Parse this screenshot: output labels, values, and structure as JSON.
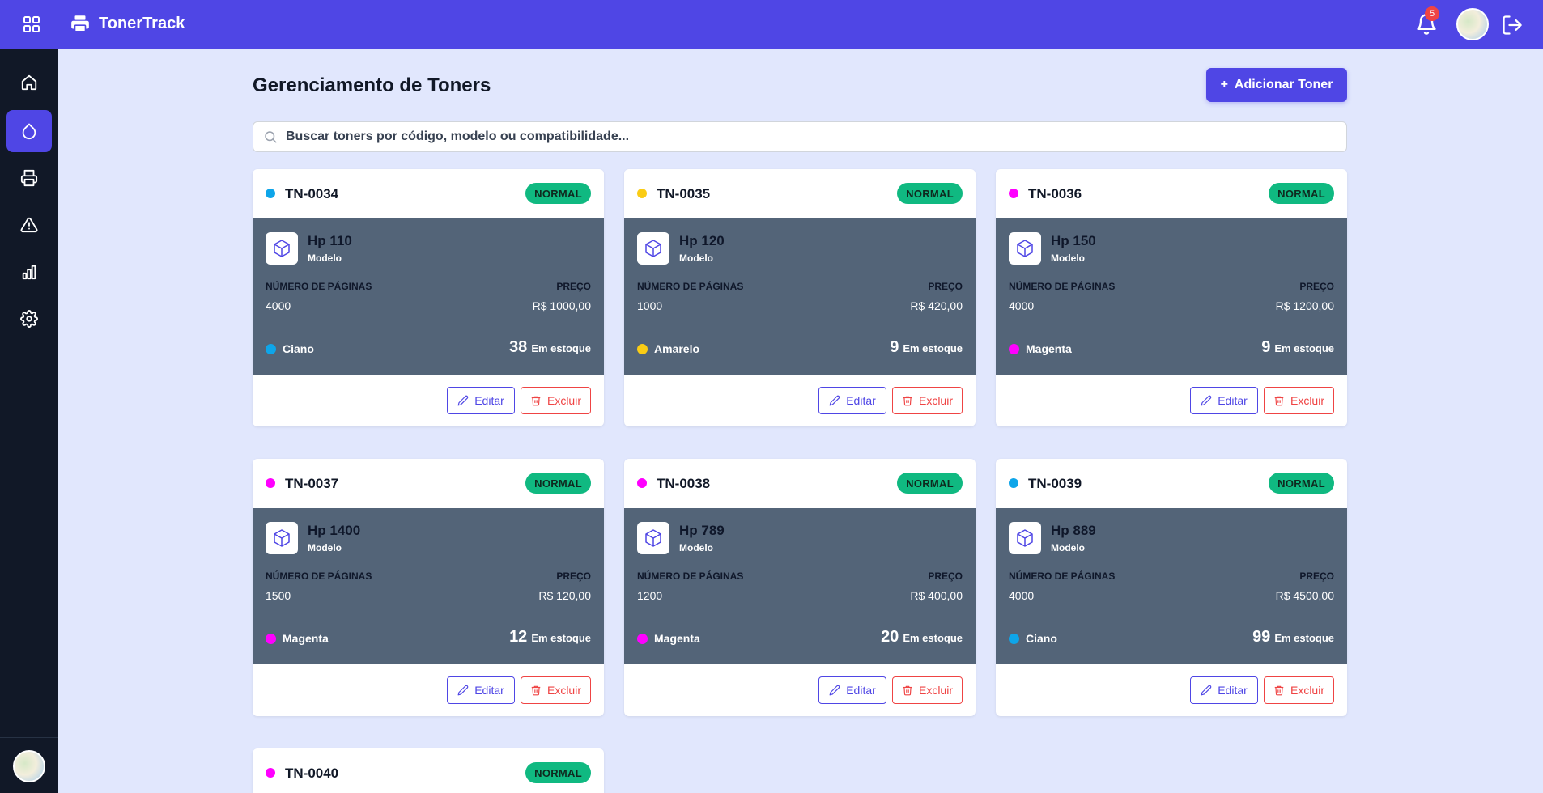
{
  "app": {
    "name": "TonerTrack",
    "notification_count": "5"
  },
  "colors": {
    "primary": "#4f46e5",
    "sidebar": "#111827",
    "status_normal": "#10b981",
    "card_body": "#536478",
    "delete": "#ef4444"
  },
  "sidebar": {
    "items": [
      {
        "name": "home",
        "icon": "home-icon"
      },
      {
        "name": "toners",
        "icon": "droplet-icon",
        "active": true
      },
      {
        "name": "printers",
        "icon": "printer-icon"
      },
      {
        "name": "alerts",
        "icon": "warning-icon"
      },
      {
        "name": "reports",
        "icon": "bar-chart-icon"
      },
      {
        "name": "settings",
        "icon": "gear-icon"
      }
    ]
  },
  "page": {
    "title": "Gerenciamento de Toners",
    "add_button": "Adicionar Toner",
    "search_placeholder": "Buscar toners por código, modelo ou compatibilidade..."
  },
  "labels": {
    "model": "Modelo",
    "pages": "NÚMERO DE PÁGINAS",
    "price": "PREÇO",
    "in_stock": "Em estoque",
    "edit": "Editar",
    "delete": "Excluir"
  },
  "toners": [
    {
      "code": "TN-0034",
      "status": "NORMAL",
      "model": "Hp 110",
      "pages": "4000",
      "price": "R$ 1000,00",
      "color": "Ciano",
      "color_hex": "#0ea5e9",
      "stock": "38"
    },
    {
      "code": "TN-0035",
      "status": "NORMAL",
      "model": "Hp 120",
      "pages": "1000",
      "price": "R$ 420,00",
      "color": "Amarelo",
      "color_hex": "#facc15",
      "stock": "9"
    },
    {
      "code": "TN-0036",
      "status": "NORMAL",
      "model": "Hp 150",
      "pages": "4000",
      "price": "R$ 1200,00",
      "color": "Magenta",
      "color_hex": "#ff00ff",
      "stock": "9"
    },
    {
      "code": "TN-0037",
      "status": "NORMAL",
      "model": "Hp 1400",
      "pages": "1500",
      "price": "R$ 120,00",
      "color": "Magenta",
      "color_hex": "#ff00ff",
      "stock": "12"
    },
    {
      "code": "TN-0038",
      "status": "NORMAL",
      "model": "Hp 789",
      "pages": "1200",
      "price": "R$ 400,00",
      "color": "Magenta",
      "color_hex": "#ff00ff",
      "stock": "20"
    },
    {
      "code": "TN-0039",
      "status": "NORMAL",
      "model": "Hp 889",
      "pages": "4000",
      "price": "R$ 4500,00",
      "color": "Ciano",
      "color_hex": "#0ea5e9",
      "stock": "99"
    },
    {
      "code": "TN-0040",
      "status": "NORMAL",
      "color_hex": "#ff00ff"
    }
  ]
}
